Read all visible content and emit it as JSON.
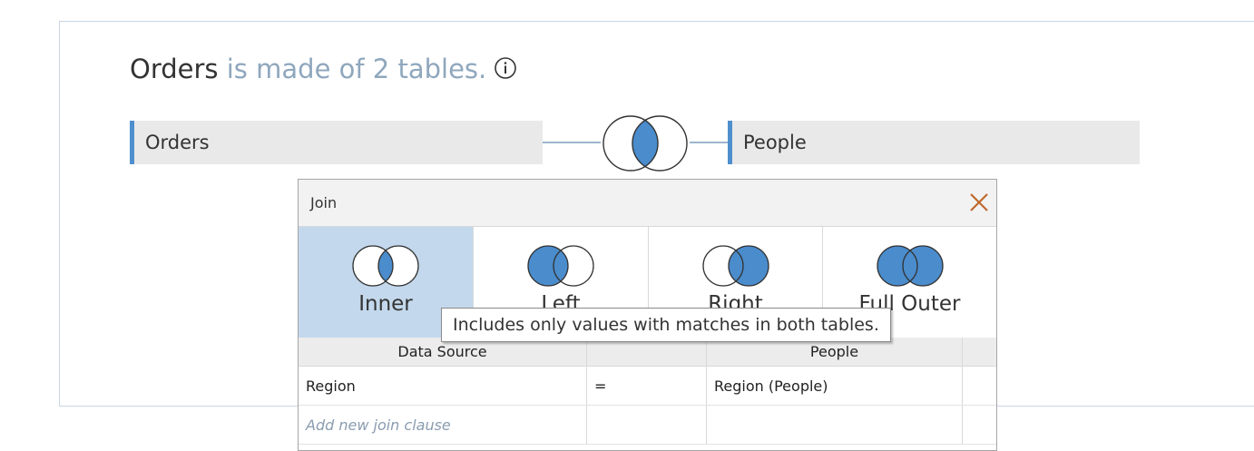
{
  "summary": {
    "name": "Orders",
    "rest": " is made of 2 tables.",
    "info_icon": "info-icon"
  },
  "tables": {
    "left": "Orders",
    "right": "People"
  },
  "colors": {
    "accent": "#4e8fce",
    "venn_fill": "#4a8ccc",
    "selected_bg": "#c3d8ec",
    "close": "#c0692e"
  },
  "dialog": {
    "title": "Join",
    "join_types": [
      {
        "label": "Inner",
        "selected": true
      },
      {
        "label": "Left",
        "selected": false
      },
      {
        "label": "Right",
        "selected": false
      },
      {
        "label": "Full Outer",
        "selected": false
      }
    ],
    "tooltip": "Includes only values with matches in both tables.",
    "columns": [
      "Data Source",
      "",
      "People",
      ""
    ],
    "clauses": [
      {
        "left": "Region",
        "op": "=",
        "right": "Region (People)"
      }
    ],
    "add_clause": "Add new join clause"
  }
}
